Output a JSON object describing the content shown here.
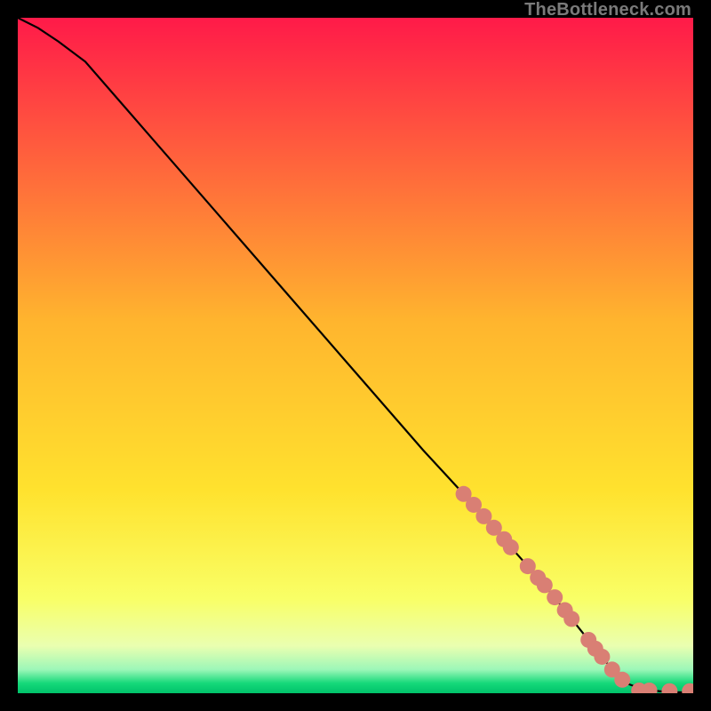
{
  "watermark": "TheBottleneck.com",
  "colors": {
    "frame": "#000000",
    "curve": "#000000",
    "marker_fill": "#d97f74",
    "marker_stroke": "#c46b60",
    "gradient_stops": [
      {
        "offset": 0.0,
        "color": "#ff1a49"
      },
      {
        "offset": 0.45,
        "color": "#ffb52e"
      },
      {
        "offset": 0.7,
        "color": "#ffe22e"
      },
      {
        "offset": 0.86,
        "color": "#f9ff66"
      },
      {
        "offset": 0.93,
        "color": "#eaffb0"
      },
      {
        "offset": 0.965,
        "color": "#9cf7b8"
      },
      {
        "offset": 0.985,
        "color": "#16d97a"
      },
      {
        "offset": 1.0,
        "color": "#00c26a"
      }
    ]
  },
  "chart_data": {
    "type": "line",
    "xlim": [
      0,
      100
    ],
    "ylim": [
      0,
      100
    ],
    "title": "",
    "xlabel": "",
    "ylabel": "",
    "series": [
      {
        "name": "curve",
        "x": [
          0,
          3,
          6,
          10,
          20,
          30,
          40,
          50,
          60,
          66,
          70,
          74,
          78,
          80,
          82,
          84,
          86,
          88,
          90,
          92.5,
          95,
          97.5,
          100
        ],
        "y": [
          100,
          98.5,
          96.5,
          93.5,
          82,
          70.5,
          59,
          47.5,
          36,
          29.5,
          25,
          20.5,
          16,
          13.5,
          11,
          8.5,
          6,
          3.5,
          1.5,
          0.6,
          0.3,
          0.15,
          0.1
        ]
      }
    ],
    "markers": [
      {
        "x": 66.0,
        "y": 29.5
      },
      {
        "x": 67.5,
        "y": 27.9
      },
      {
        "x": 69.0,
        "y": 26.2
      },
      {
        "x": 70.5,
        "y": 24.5
      },
      {
        "x": 72.0,
        "y": 22.8
      },
      {
        "x": 73.0,
        "y": 21.6
      },
      {
        "x": 75.5,
        "y": 18.8
      },
      {
        "x": 77.0,
        "y": 17.1
      },
      {
        "x": 78.0,
        "y": 16.0
      },
      {
        "x": 79.5,
        "y": 14.2
      },
      {
        "x": 81.0,
        "y": 12.3
      },
      {
        "x": 82.0,
        "y": 11.0
      },
      {
        "x": 84.5,
        "y": 7.9
      },
      {
        "x": 85.5,
        "y": 6.6
      },
      {
        "x": 86.5,
        "y": 5.4
      },
      {
        "x": 88.0,
        "y": 3.5
      },
      {
        "x": 89.5,
        "y": 2.0
      },
      {
        "x": 92.0,
        "y": 0.4
      },
      {
        "x": 93.5,
        "y": 0.4
      },
      {
        "x": 96.5,
        "y": 0.3
      },
      {
        "x": 99.5,
        "y": 0.3
      }
    ]
  }
}
